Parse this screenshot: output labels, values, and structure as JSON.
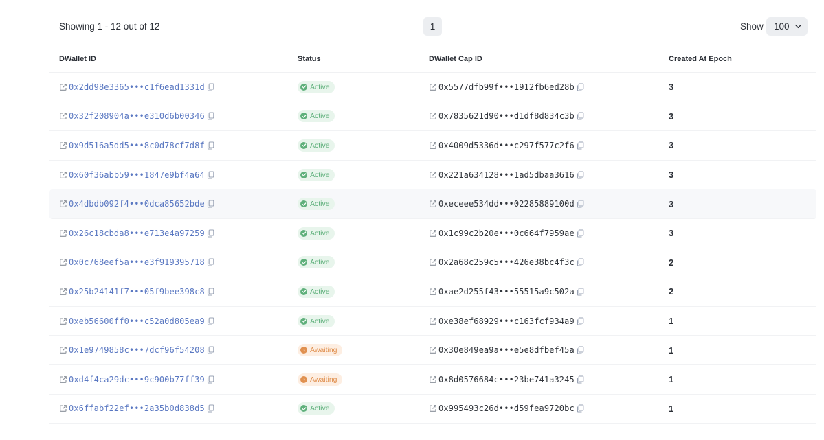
{
  "pagination": {
    "showing_text": "Showing 1 - 12 out of 12",
    "current_page": "1",
    "show_label": "Show",
    "page_size": "100"
  },
  "table": {
    "headers": {
      "dwallet_id": "DWallet ID",
      "status": "Status",
      "dwallet_cap_id": "DWallet Cap ID",
      "created_at_epoch": "Created At Epoch"
    },
    "rows": [
      {
        "dwallet_id": "0x2dd98e3365•••c1f6ead1331d",
        "status": "Active",
        "cap_id": "0x5577dfb99f•••1912fb6ed28b",
        "epoch": "3"
      },
      {
        "dwallet_id": "0x32f208904a•••e310d6b00346",
        "status": "Active",
        "cap_id": "0x7835621d90•••d1df8d834c3b",
        "epoch": "3"
      },
      {
        "dwallet_id": "0x9d516a5dd5•••8c0d78cf7d8f",
        "status": "Active",
        "cap_id": "0x4009d5336d•••c297f577c2f6",
        "epoch": "3"
      },
      {
        "dwallet_id": "0x60f36abb59•••1847e9bf4a64",
        "status": "Active",
        "cap_id": "0x221a634128•••1ad5dbaa3616",
        "epoch": "3"
      },
      {
        "dwallet_id": "0x4dbdb092f4•••0dca85652bde",
        "status": "Active",
        "cap_id": "0xeceee534dd•••02285889100d",
        "epoch": "3"
      },
      {
        "dwallet_id": "0x26c18cbda8•••e713e4a97259",
        "status": "Active",
        "cap_id": "0x1c99c2b20e•••0c664f7959ae",
        "epoch": "3"
      },
      {
        "dwallet_id": "0x0c768eef5a•••e3f919395718",
        "status": "Active",
        "cap_id": "0x2a68c259c5•••426e38bc4f3c",
        "epoch": "2"
      },
      {
        "dwallet_id": "0x25b24141f7•••05f9bee398c8",
        "status": "Active",
        "cap_id": "0xae2d255f43•••55515a9c502a",
        "epoch": "2"
      },
      {
        "dwallet_id": "0xeb56600ff0•••c52a0d805ea9",
        "status": "Active",
        "cap_id": "0xe38ef68929•••c163fcf934a9",
        "epoch": "1"
      },
      {
        "dwallet_id": "0x1e9749858c•••7dcf96f54208",
        "status": "Awaiting",
        "cap_id": "0x30e849ea9a•••e5e8dfbef45a",
        "epoch": "1"
      },
      {
        "dwallet_id": "0xd4f4ca29dc•••9c900b77ff39",
        "status": "Awaiting",
        "cap_id": "0x8d0576684c•••23be741a3245",
        "epoch": "1"
      },
      {
        "dwallet_id": "0x6ffabf22ef•••2a35b0d838d5",
        "status": "Active",
        "cap_id": "0x995493c26d•••d59fea9720bc",
        "epoch": "1"
      }
    ]
  },
  "icons": {
    "external_link": "external-link-icon",
    "copy": "copy-icon",
    "status_active": "check-circle-icon",
    "status_awaiting": "clock-icon",
    "dropdown": "chevron-down-icon"
  },
  "colors": {
    "link": "#5a78c2",
    "active_bg": "#e8f5ec",
    "active_fg": "#5fb07b",
    "awaiting_bg": "#fdeee2",
    "awaiting_fg": "#e0904f"
  }
}
